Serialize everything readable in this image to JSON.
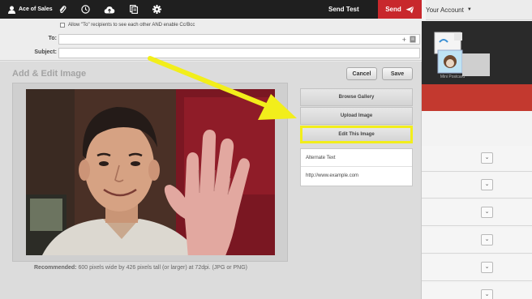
{
  "topbar": {
    "account_name": "Ace of Sales",
    "send_test_label": "Send Test",
    "send_label": "Send",
    "icons": [
      "person-icon",
      "paperclip-icon",
      "clock-icon",
      "cloud-upload-icon",
      "copy-icon",
      "gear-icon",
      "paper-plane-icon"
    ]
  },
  "right_panel": {
    "account_menu": "Your Account",
    "postcard_caption": "Mini Postcard"
  },
  "compose": {
    "allow_label": "Allow \"To\" recipients to see each other AND enable Cc/Bcc",
    "to_label": "To:",
    "subject_label": "Subject:",
    "to_value": "",
    "subject_value": ""
  },
  "modal": {
    "title": "Add & Edit Image",
    "cancel_label": "Cancel",
    "save_label": "Save",
    "browse_gallery": "Browse Gallery",
    "upload_image": "Upload Image",
    "edit_image": "Edit This Image",
    "alt_text_placeholder": "Alternate Text",
    "url_value": "http://www.example.com",
    "recommended_bold": "Recommended:",
    "recommended_text": "600 pixels wide by 426 pixels tall (or larger) at 72dpi. (JPG or PNG)"
  },
  "colors": {
    "topbar_bg": "#1f1f1f",
    "send_red": "#c8282c",
    "highlight_yellow": "#f2ee1b",
    "modal_bg": "#dcdcdc"
  }
}
